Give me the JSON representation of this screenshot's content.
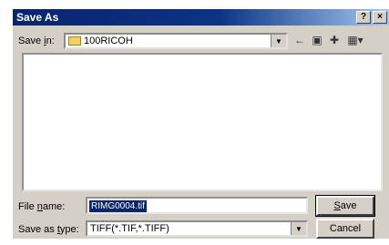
{
  "window": {
    "title": "Save As",
    "help_button": "?",
    "close_button": "×"
  },
  "save_in": {
    "label_pre": "Save ",
    "label_key": "i",
    "label_post": "n:",
    "value": "100RICOH"
  },
  "toolbar": {
    "back_icon": "←",
    "up_icon": "▣",
    "new_folder_icon": "✚",
    "view_icon": "▦▾"
  },
  "file_name": {
    "label_pre": "File ",
    "label_key": "n",
    "label_post": "ame:",
    "value": "RIMG0004.tif"
  },
  "save_as_type": {
    "label_pre": "Save as ",
    "label_key": "t",
    "label_post": "ype:",
    "value": "TIFF(*.TIF,*.TIFF)"
  },
  "buttons": {
    "save_key": "S",
    "save_rest": "ave",
    "cancel": "Cancel"
  }
}
